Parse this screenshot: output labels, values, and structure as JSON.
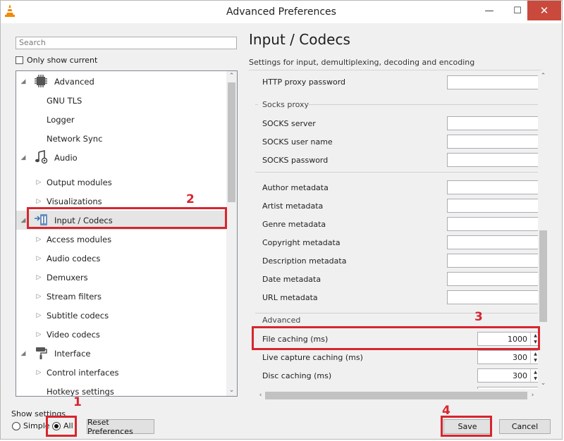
{
  "window": {
    "title": "Advanced Preferences",
    "min_glyph": "—",
    "max_glyph": "☐",
    "close_glyph": "✕"
  },
  "sidebar": {
    "search_placeholder": "Search",
    "only_show_current": "Only show current",
    "tree": [
      {
        "label": "Advanced",
        "icon": "chip-icon",
        "level": 0,
        "expanded": true
      },
      {
        "label": "GNU TLS",
        "level": 1
      },
      {
        "label": "Logger",
        "level": 1
      },
      {
        "label": "Network Sync",
        "level": 1
      },
      {
        "label": "Audio",
        "icon": "audio-icon",
        "level": 0,
        "expanded": true
      },
      {
        "label": "Output modules",
        "level": 1,
        "collapsed": true
      },
      {
        "label": "Visualizations",
        "level": 1,
        "collapsed": true
      },
      {
        "label": "Input / Codecs",
        "icon": "input-codecs-icon",
        "level": 0,
        "expanded": true,
        "selected": true
      },
      {
        "label": "Access modules",
        "level": 1,
        "collapsed": true
      },
      {
        "label": "Audio codecs",
        "level": 1,
        "collapsed": true
      },
      {
        "label": "Demuxers",
        "level": 1,
        "collapsed": true
      },
      {
        "label": "Stream filters",
        "level": 1,
        "collapsed": true
      },
      {
        "label": "Subtitle codecs",
        "level": 1,
        "collapsed": true
      },
      {
        "label": "Video codecs",
        "level": 1,
        "collapsed": true
      },
      {
        "label": "Interface",
        "icon": "paint-roller-icon",
        "level": 0,
        "expanded": true
      },
      {
        "label": "Control interfaces",
        "level": 1,
        "collapsed": true
      },
      {
        "label": "Hotkeys settings",
        "level": 1
      }
    ]
  },
  "main": {
    "title": "Input / Codecs",
    "subtitle": "Settings for input, demultiplexing, decoding and encoding",
    "http_proxy_password": "HTTP proxy password",
    "socks_group": "Socks proxy",
    "socks_server": "SOCKS server",
    "socks_user": "SOCKS user name",
    "socks_password": "SOCKS password",
    "author_metadata": "Author metadata",
    "artist_metadata": "Artist metadata",
    "genre_metadata": "Genre metadata",
    "copyright_metadata": "Copyright metadata",
    "description_metadata": "Description metadata",
    "date_metadata": "Date metadata",
    "url_metadata": "URL metadata",
    "advanced_group": "Advanced",
    "file_caching_label": "File caching (ms)",
    "file_caching_value": "1000",
    "live_caching_label": "Live capture caching (ms)",
    "live_caching_value": "300",
    "disc_caching_label": "Disc caching (ms)",
    "disc_caching_value": "300"
  },
  "footer": {
    "show_settings": "Show settings",
    "simple": "Simple",
    "all": "All",
    "selected_mode": "All",
    "reset": "Reset Preferences",
    "save": "Save",
    "cancel": "Cancel"
  },
  "annotations": {
    "n1": "1",
    "n2": "2",
    "n3": "3",
    "n4": "4",
    "color": "#d7262e"
  },
  "colors": {
    "close_button": "#c9493c",
    "annotation_red": "#d7262e",
    "vlc_orange": "#f08a00"
  }
}
